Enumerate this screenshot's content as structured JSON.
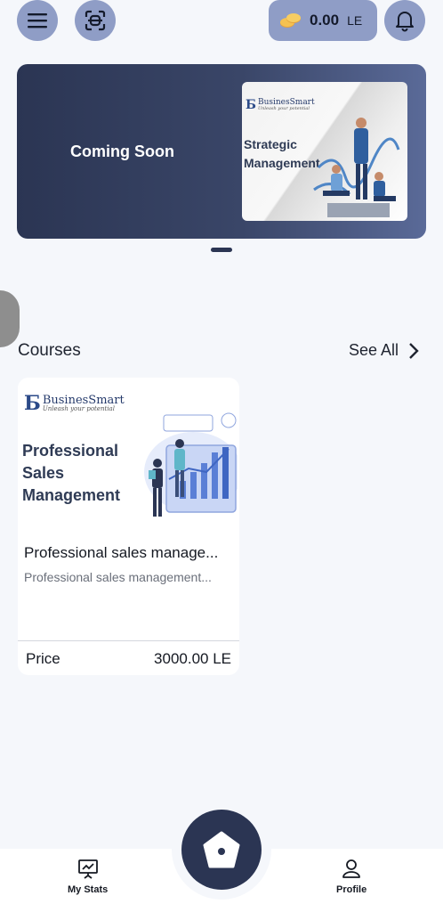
{
  "header": {
    "menu_icon": "hamburger-menu-icon",
    "scan_icon": "scan-icon",
    "wallet": {
      "amount": "0.00",
      "currency": "LE",
      "icon": "coins-icon"
    },
    "bell_icon": "bell-icon"
  },
  "banner": {
    "label": "Coming Soon",
    "poster": {
      "brand": "BusinesSmart",
      "tagline": "Unleash your potential",
      "title_line1": "Strategic",
      "title_line2": "Management"
    }
  },
  "courses": {
    "title": "Courses",
    "see_all": "See All",
    "items": [
      {
        "thumb_brand": "BusinesSmart",
        "thumb_tagline": "Unleash your potential",
        "thumb_title_line1": "Professional",
        "thumb_title_line2": "Sales",
        "thumb_title_line3": "Management",
        "title": "Professional sales manage...",
        "subtitle": "Professional sales management...",
        "price_label": "Price",
        "price": "3000.00 LE"
      }
    ]
  },
  "bottom_nav": {
    "stats_label": "My Stats",
    "profile_label": "Profile",
    "home_icon": "home-icon"
  },
  "colors": {
    "accent": "#8f9dc6",
    "dark": "#2b3553",
    "background": "#f5f7fb"
  }
}
